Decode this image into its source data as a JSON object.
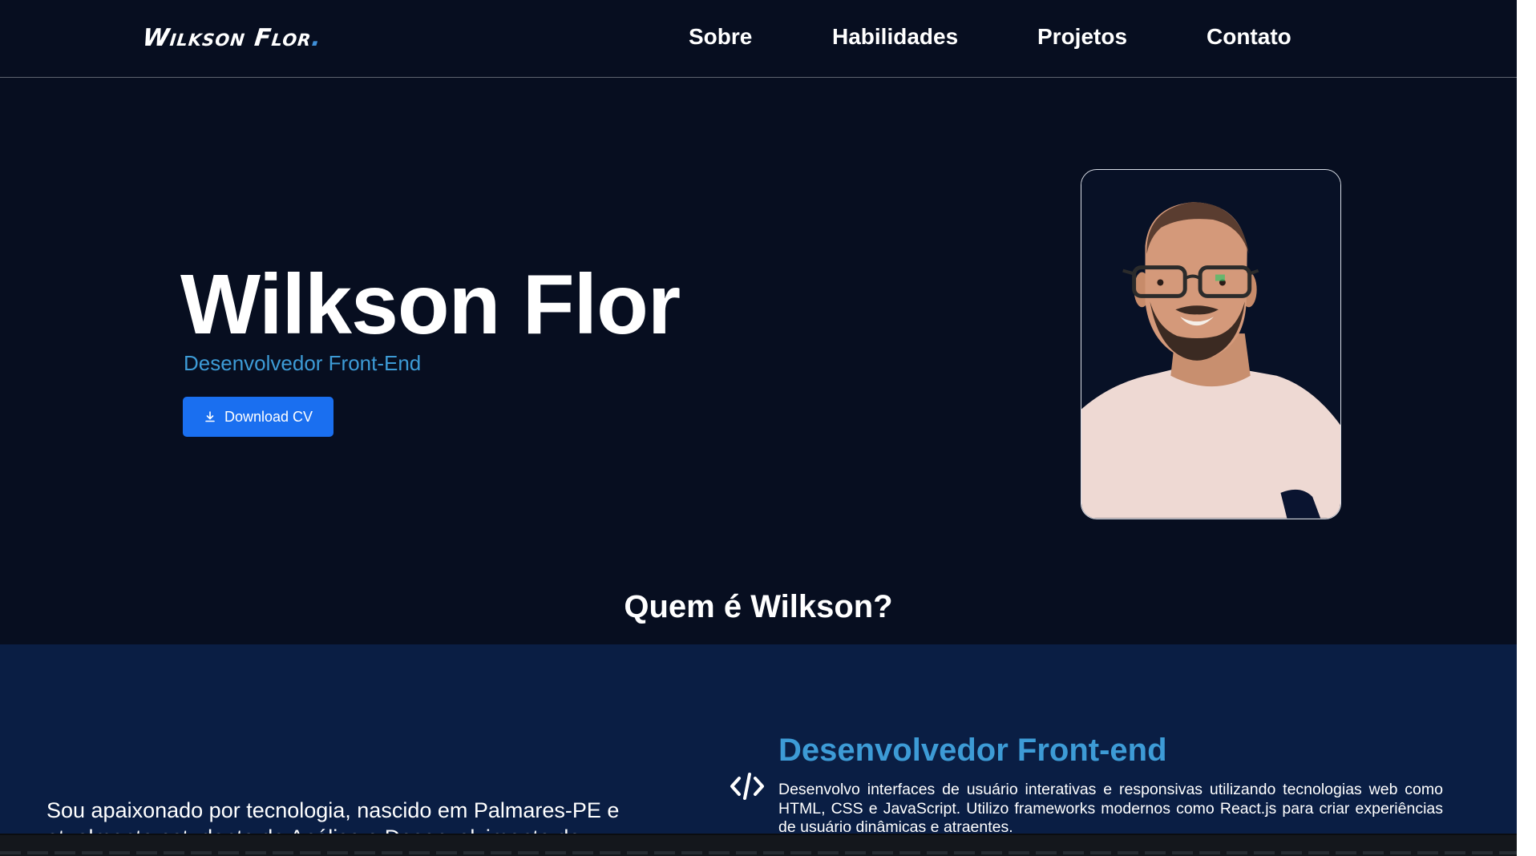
{
  "header": {
    "logo": "Wilkson Flor",
    "logo_dot": ".",
    "nav": [
      "Sobre",
      "Habilidades",
      "Projetos",
      "Contato"
    ]
  },
  "hero": {
    "name": "Wilkson Flor",
    "role": "Desenvolvedor Front-End",
    "download_label": "Download CV",
    "download_icon": "download-icon",
    "photo_alt": "profile-photo"
  },
  "about": {
    "heading": "Quem é Wilkson?",
    "text": "Sou apaixonado por tecnologia, nascido em Palmares-PE e atualmente estudante de Análise e Desenvolvimento de",
    "card": {
      "icon": "code-icon",
      "title": "Desenvolvedor Front-end",
      "description": "Desenvolvo interfaces de usuário interativas e responsivas utilizando tecnologias web como HTML, CSS e JavaScript. Utilizo frameworks modernos como React.js para criar experiências de usuário dinâmicas e atraentes."
    }
  },
  "colors": {
    "background": "#070e20",
    "section_background": "#0a1e44",
    "accent": "#3d9bd6",
    "button": "#1a6ff0"
  }
}
